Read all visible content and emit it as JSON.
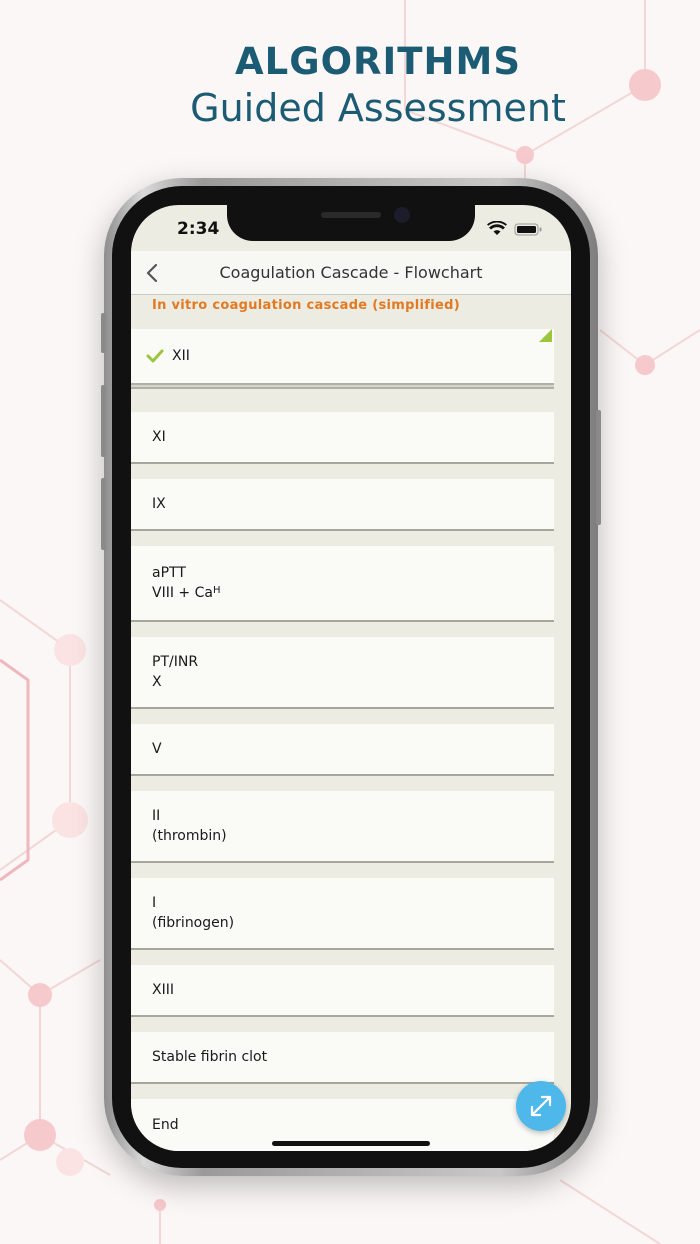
{
  "headline": {
    "title": "ALGORITHMS",
    "subtitle": "Guided Assessment"
  },
  "status_bar": {
    "time": "2:34"
  },
  "navbar": {
    "title": "Coagulation Cascade - Flowchart",
    "back_icon": "chevron-left-icon"
  },
  "section": {
    "heading": "In vitro coagulation cascade (simplified)"
  },
  "cards": [
    {
      "line1": "XII",
      "line2": "",
      "checked": true
    },
    {
      "line1": "XI",
      "line2": ""
    },
    {
      "line1": "IX",
      "line2": ""
    },
    {
      "line1": "aPTT",
      "line2": "VIII + Ca",
      "sup": "H"
    },
    {
      "line1": "PT/INR",
      "line2": "X"
    },
    {
      "line1": "V",
      "line2": ""
    },
    {
      "line1": "II",
      "line2": "(thrombin)"
    },
    {
      "line1": "I",
      "line2": "(fibrinogen)"
    },
    {
      "line1": "XIII",
      "line2": ""
    },
    {
      "line1": "Stable fibrin clot",
      "line2": ""
    },
    {
      "line1": "End",
      "line2": ""
    }
  ],
  "fab": {
    "icon": "expand-icon"
  },
  "colors": {
    "brand": "#1b5b73",
    "accent": "#e07a23",
    "check": "#9bc53d",
    "fab": "#4fb8ea"
  }
}
